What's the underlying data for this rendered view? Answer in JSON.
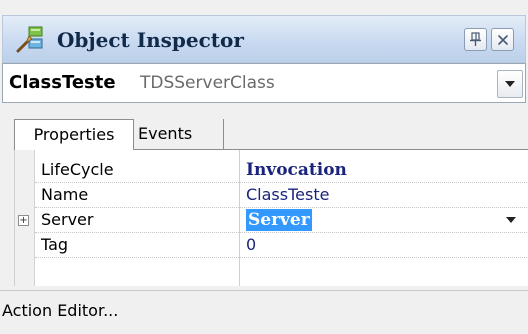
{
  "window": {
    "title": "Object Inspector",
    "icons": {
      "title": "object-inspector-icon",
      "pin": "pin-icon",
      "close": "close-icon"
    }
  },
  "selector": {
    "object_name": "ClassTeste",
    "object_type": "TDSServerClass",
    "dropdown_icon": "chevron-down-icon"
  },
  "tabs": [
    {
      "label": "Properties",
      "active": true
    },
    {
      "label": "Events",
      "active": false
    }
  ],
  "properties": [
    {
      "name": "LifeCycle",
      "value": "Invocation"
    },
    {
      "name": "Name",
      "value": "ClassTeste"
    },
    {
      "name": "Server",
      "value": "Server",
      "expandable": true,
      "expand_symbol": "+"
    },
    {
      "name": "Tag",
      "value": "0"
    }
  ],
  "action": {
    "label": "Action Editor..."
  },
  "colors": {
    "selection": "#3399ff",
    "value_text": "#1a237e",
    "title_gradient_top": "#e4edf8",
    "title_gradient_bottom": "#bcd0ea"
  }
}
